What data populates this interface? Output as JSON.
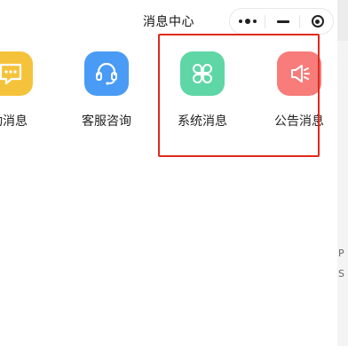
{
  "navbar": {
    "title": "消息中心"
  },
  "capsule": {
    "more_icon": "more-dots-icon",
    "minimize_icon": "minimize-icon",
    "close_icon": "close-target-icon"
  },
  "menu": [
    {
      "key": "activity",
      "label": "动消息",
      "icon": "chat-bubble-icon",
      "color": "#F5C33B"
    },
    {
      "key": "service",
      "label": "客服咨询",
      "icon": "headset-icon",
      "color": "#4A9BF5"
    },
    {
      "key": "system",
      "label": "系统消息",
      "icon": "clover-icon",
      "color": "#5ED6A6"
    },
    {
      "key": "notice",
      "label": "公告消息",
      "icon": "speaker-icon",
      "color": "#F77C7A"
    }
  ],
  "highlight": {
    "color": "#E02A1D"
  },
  "side_panel": {
    "line1": "P",
    "line2": "S"
  }
}
